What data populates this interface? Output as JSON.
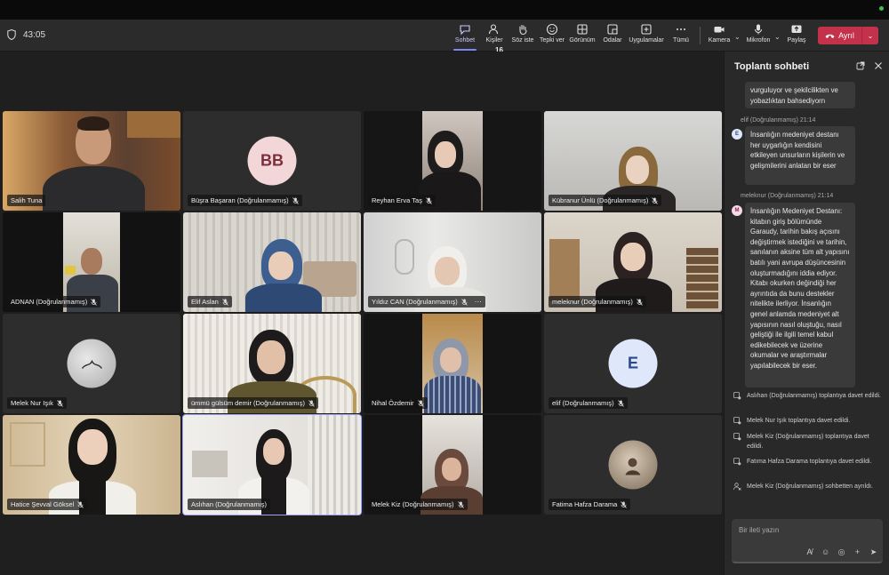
{
  "call": {
    "timer": "43:05"
  },
  "toolbar": {
    "items": [
      {
        "label": "Sohbet",
        "icon": "chat-icon"
      },
      {
        "label": "Kişiler",
        "icon": "people-icon",
        "badge": "16"
      },
      {
        "label": "Söz iste",
        "icon": "raise-hand-icon"
      },
      {
        "label": "Tepki ver",
        "icon": "emoji-icon"
      },
      {
        "label": "Görünüm",
        "icon": "grid-view-icon"
      },
      {
        "label": "Odalar",
        "icon": "rooms-icon"
      },
      {
        "label": "Uygulamalar",
        "icon": "apps-icon"
      },
      {
        "label": "Tümü",
        "icon": "more-icon"
      },
      {
        "label": "Kamera",
        "icon": "camera-icon"
      },
      {
        "label": "Mikrofon",
        "icon": "mic-icon"
      },
      {
        "label": "Paylaş",
        "icon": "share-icon"
      }
    ],
    "leave_label": "Ayrıl",
    "accent": "#7f85f5",
    "leave_color": "#c4314b"
  },
  "tiles": [
    {
      "name": "Salih Tuna"
    },
    {
      "name": "Büşra Başaran (Doğrulanmamış)",
      "initials": "BB"
    },
    {
      "name": "Reyhan Erva Taş"
    },
    {
      "name": "Kübranur Ünlü (Doğrulanmamış)"
    },
    {
      "name": "ADNAN (Doğrulanmamış)"
    },
    {
      "name": "Elif Aslan"
    },
    {
      "name": "Yıldız CAN (Doğrulanmamış)"
    },
    {
      "name": "meleknur (Doğrulanmamış)"
    },
    {
      "name": "Melek Nur Işık"
    },
    {
      "name": "ümmü gülsüm demir (Doğrulanmamış)"
    },
    {
      "name": "Nihal Özdemir"
    },
    {
      "name": "elif (Doğrulanmamış)",
      "initials": "E"
    },
    {
      "name": "Hatice Şevval Göksel"
    },
    {
      "name": "Aslıhan (Doğrulanmamış)"
    },
    {
      "name": "Melek Kiz (Doğrulanmamış)"
    },
    {
      "name": "Fatima Hafza Darama"
    }
  ],
  "chat": {
    "title": "Toplantı sohbeti",
    "messages": [
      {
        "sender": "",
        "text": "vurguluyor ve şekilcilikten  ve yobazlıktan bahsediyorn"
      },
      {
        "sender": "elif (Doğrulanmamış)  21:14",
        "initial": "E",
        "text": "İnsanlığın medeniyet destanı her uygarlığın kendisini etkileyen unsurların kişilerin ve  gelişmilerini anlatan bir eser"
      },
      {
        "sender": "meleknur (Doğrulanmamış)  21:14",
        "initial": "M",
        "text": "İnsanlığın Medeniyet Destanı: kitabın giriş bölümünde Garaudy, tarihin bakış açısını değiştirmek istediğini ve tarihin, sanılanın aksine tüm alt yapısını batılı yani avrupa düşüncesinin oluşturmadığını iddia ediyor. Kitabı okurken değindiği her ayrıntıda da bunu destekler nitelikte ilerliyor. İnsanlığın genel anlamda medeniyet alt yapısının nasıl oluştuğu, nasıl geliştiği ile ilgili temel kabul edikebilecek ve üzerine okumalar ve araştırmalar yapılabilecek bir eser."
      }
    ],
    "system": [
      "Aslıhan (Doğrulanmamış) toplantıya davet edildi.",
      "Melek Nur Işık toplantıya davet edildi.",
      "Melek Kiz (Doğrulanmamış) toplantıya davet edildi.",
      "Fatıma Hafza Darama toplantıya davet edildi.",
      "Melek Kiz (Doğrulanmamış) sohbetten ayrıldı."
    ],
    "composer_placeholder": "Bir ileti yazın"
  }
}
